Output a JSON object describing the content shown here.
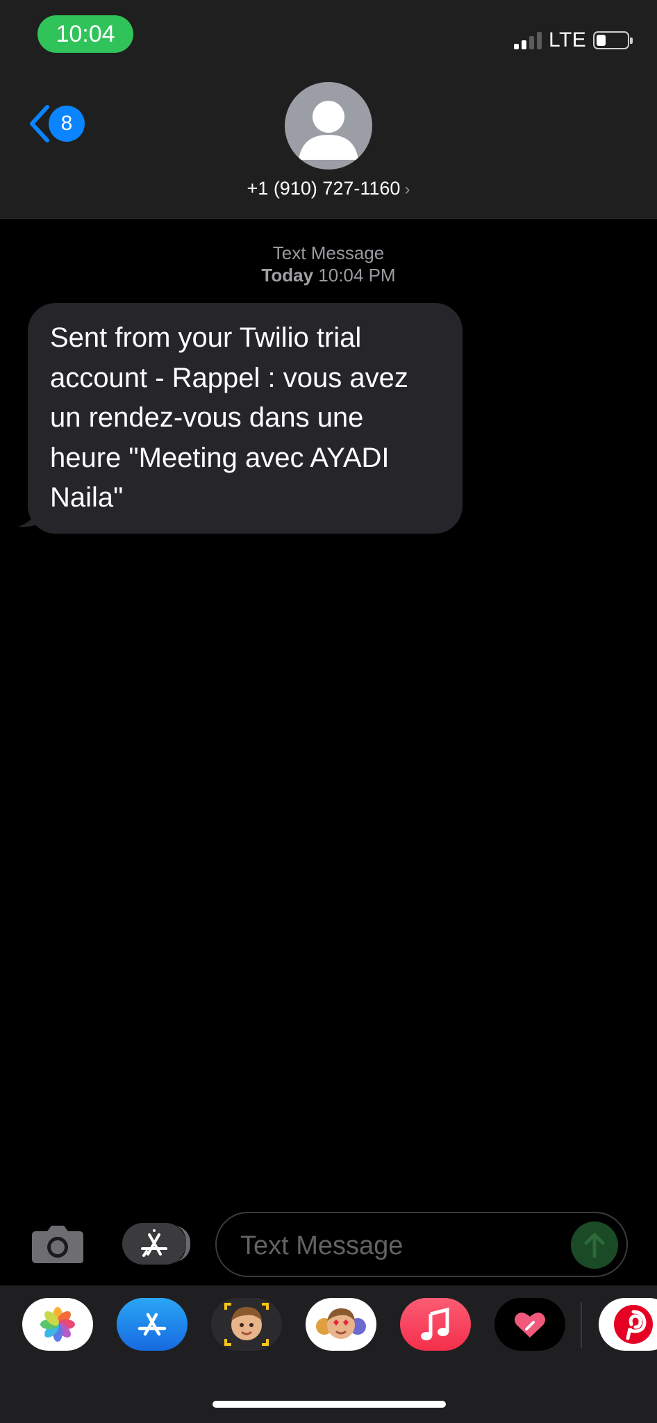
{
  "status_bar": {
    "time": "10:04",
    "network": "LTE",
    "signal_bars": 2,
    "battery_level": 0.25
  },
  "header": {
    "back_badge": "8",
    "contact_name": "+1 (910) 727-1160",
    "chevron": "›"
  },
  "conversation": {
    "service_label": "Text Message",
    "timestamp_day": "Today",
    "timestamp_time": "10:04 PM",
    "messages": [
      {
        "direction": "incoming",
        "text": "Sent from your Twilio trial account - Rappel : vous avez un rendez-vous dans une heure \"Meeting avec AYADI Naila\""
      }
    ]
  },
  "composer": {
    "placeholder": "Text Message"
  },
  "app_drawer": {
    "apps": [
      {
        "name": "photos-app-icon"
      },
      {
        "name": "app-store-icon"
      },
      {
        "name": "memoji-camera-icon"
      },
      {
        "name": "memoji-stickers-icon"
      },
      {
        "name": "music-app-icon"
      },
      {
        "name": "digital-touch-icon"
      },
      {
        "name": "pinterest-icon"
      }
    ]
  },
  "colors": {
    "accent": "#0a84ff",
    "status_pill": "#30c35a",
    "bubble": "#26262a",
    "music": "#fa3e5a",
    "pinterest": "#e60023"
  }
}
